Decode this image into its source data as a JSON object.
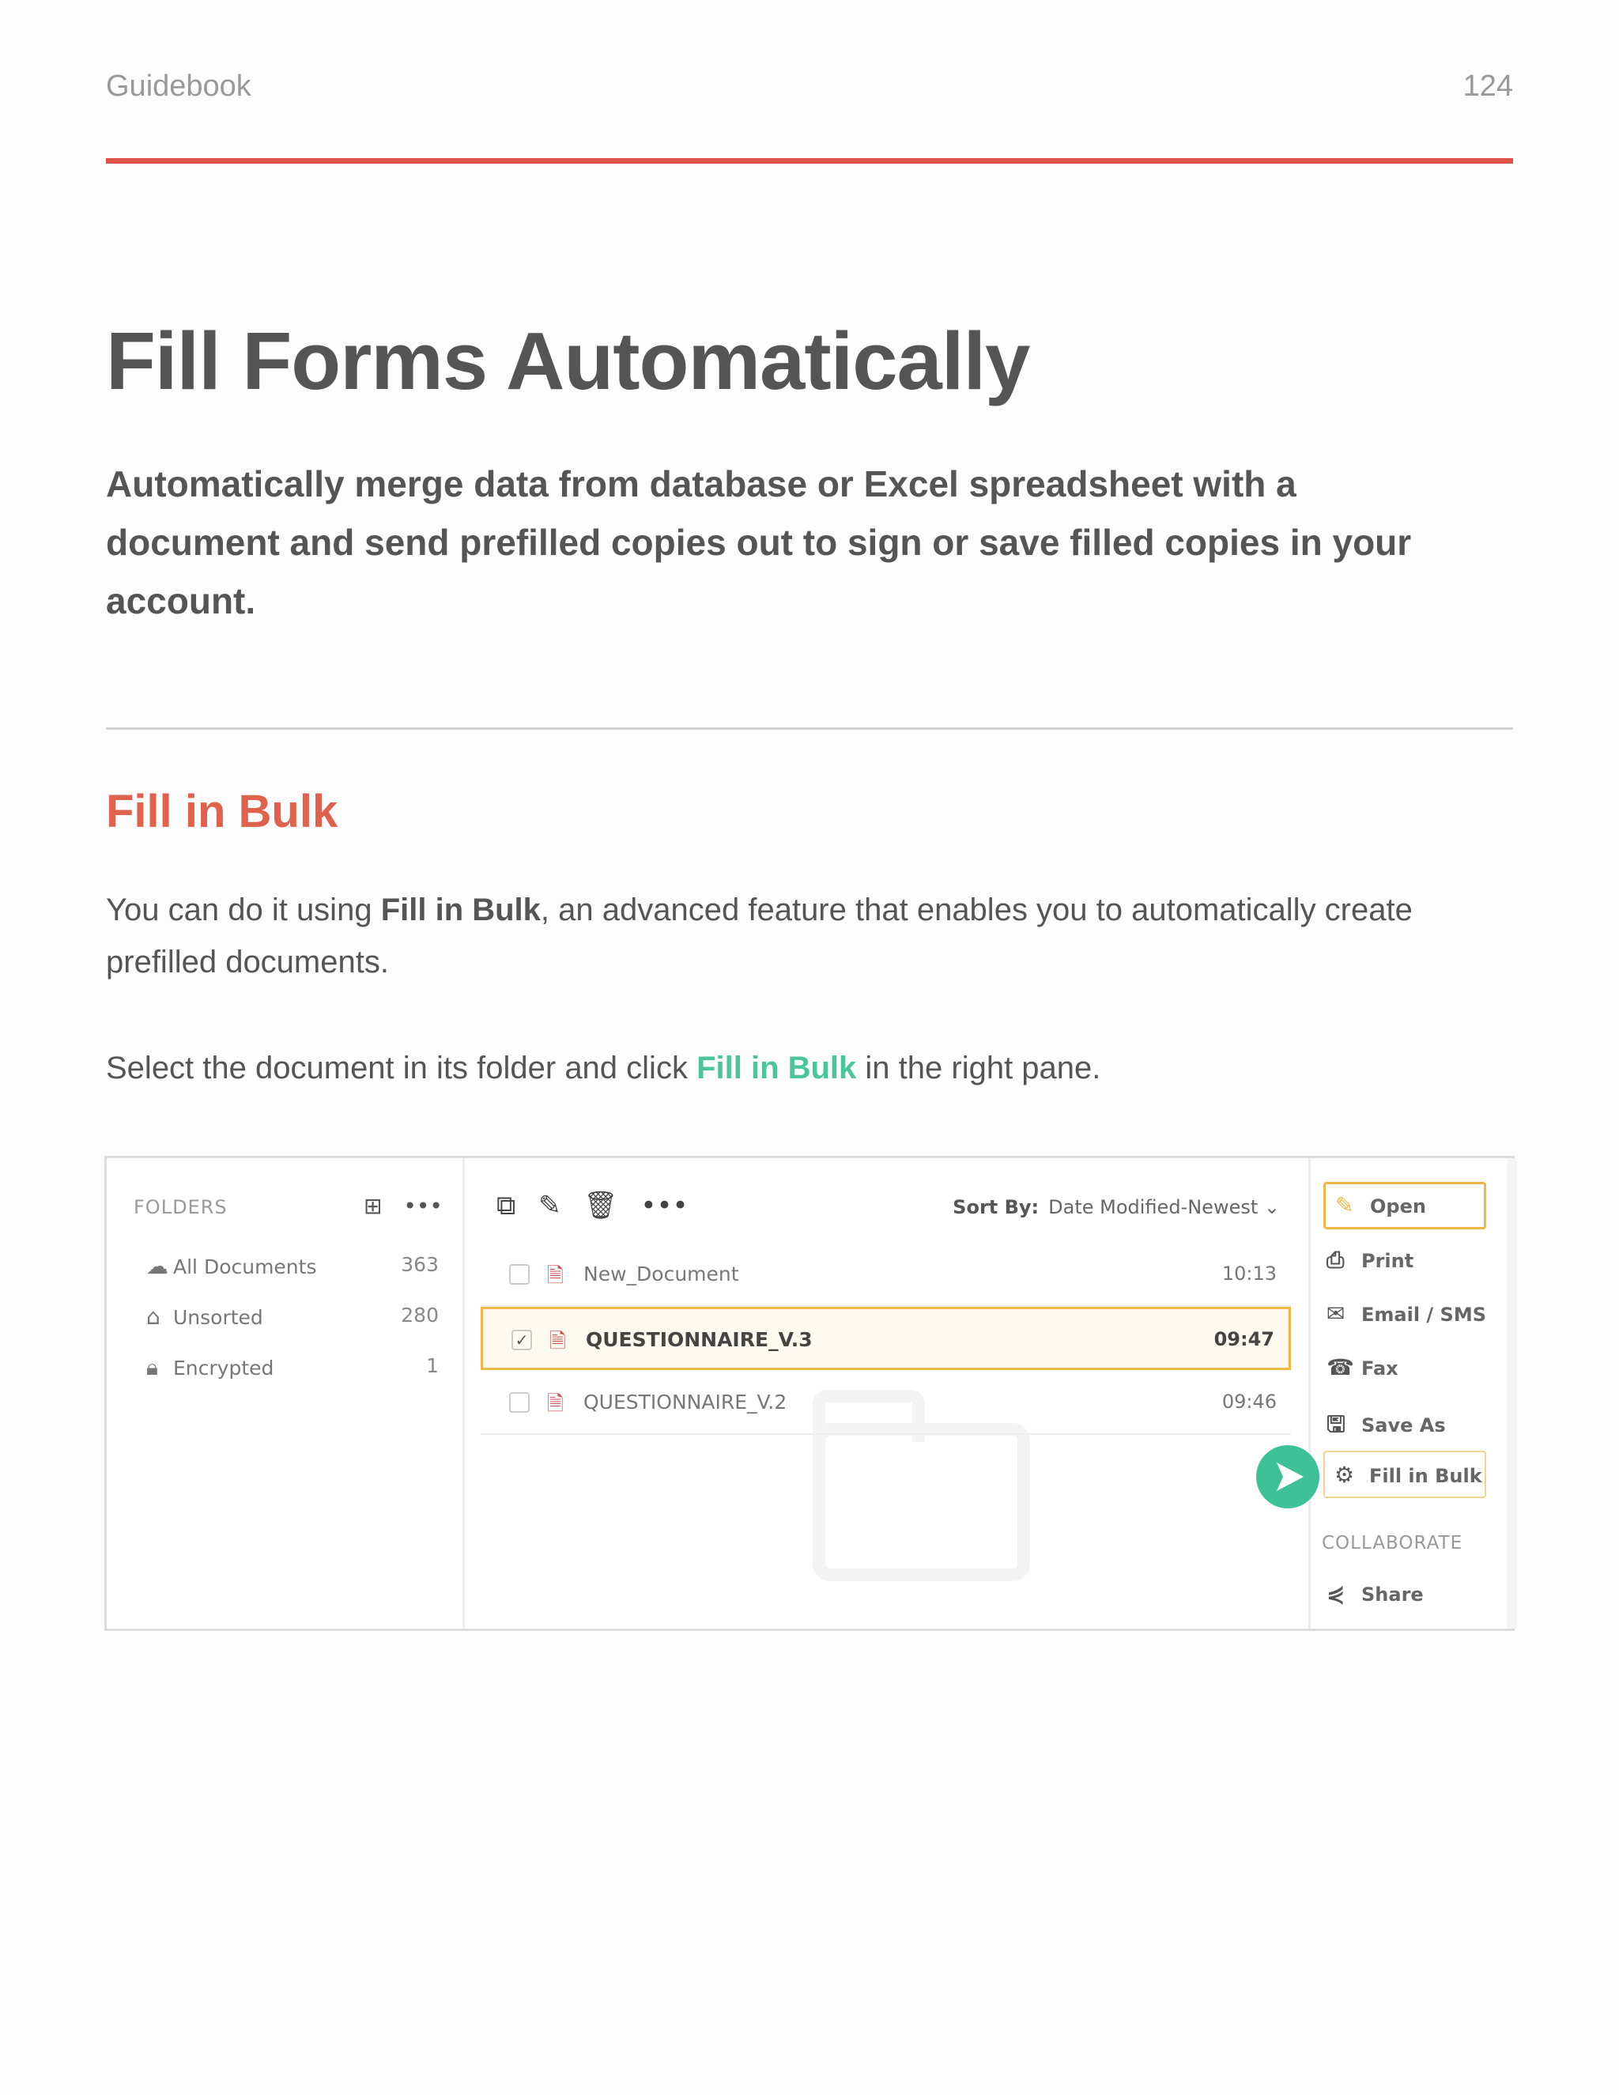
{
  "header": {
    "left": "Guidebook",
    "page_number": "124"
  },
  "title": "Fill Forms Automatically",
  "lead": "Automatically merge data from database or Excel spreadsheet with a document and send prefilled copies out to sign or save filled copies in your account.",
  "section": {
    "title": "Fill in Bulk",
    "p1_pre": "You can do it using ",
    "p1_bold": "Fill in Bulk",
    "p1_post": ", an advanced feature that enables you to automatically create prefilled documents.",
    "p2_pre": "Select the document in its folder and click ",
    "p2_link": "Fill in Bulk",
    "p2_post": " in the right pane."
  },
  "screenshot": {
    "folders_heading": "FOLDERS",
    "folders": [
      {
        "icon": "cloud-icon",
        "label": "All Documents",
        "count": "363"
      },
      {
        "icon": "home-icon",
        "label": "Unsorted",
        "count": "280"
      },
      {
        "icon": "lock-icon",
        "label": "Encrypted",
        "count": "1"
      }
    ],
    "sort_label": "Sort By:",
    "sort_value": "Date Modified-Newest",
    "documents": [
      {
        "name": "New_Document",
        "time": "10:13",
        "selected": false
      },
      {
        "name": "QUESTIONNAIRE_V.3",
        "time": "09:47",
        "selected": true
      },
      {
        "name": "QUESTIONNAIRE_V.2",
        "time": "09:46",
        "selected": false
      }
    ],
    "actions": {
      "open": "Open",
      "print": "Print",
      "email": "Email / SMS",
      "fax": "Fax",
      "save_as": "Save As",
      "fill_in_bulk": "Fill in Bulk",
      "collaborate_heading": "COLLABORATE",
      "share": "Share"
    },
    "colors": {
      "accent": "#efb746",
      "pointer": "#3ec197",
      "heading": "#e0614c"
    }
  }
}
